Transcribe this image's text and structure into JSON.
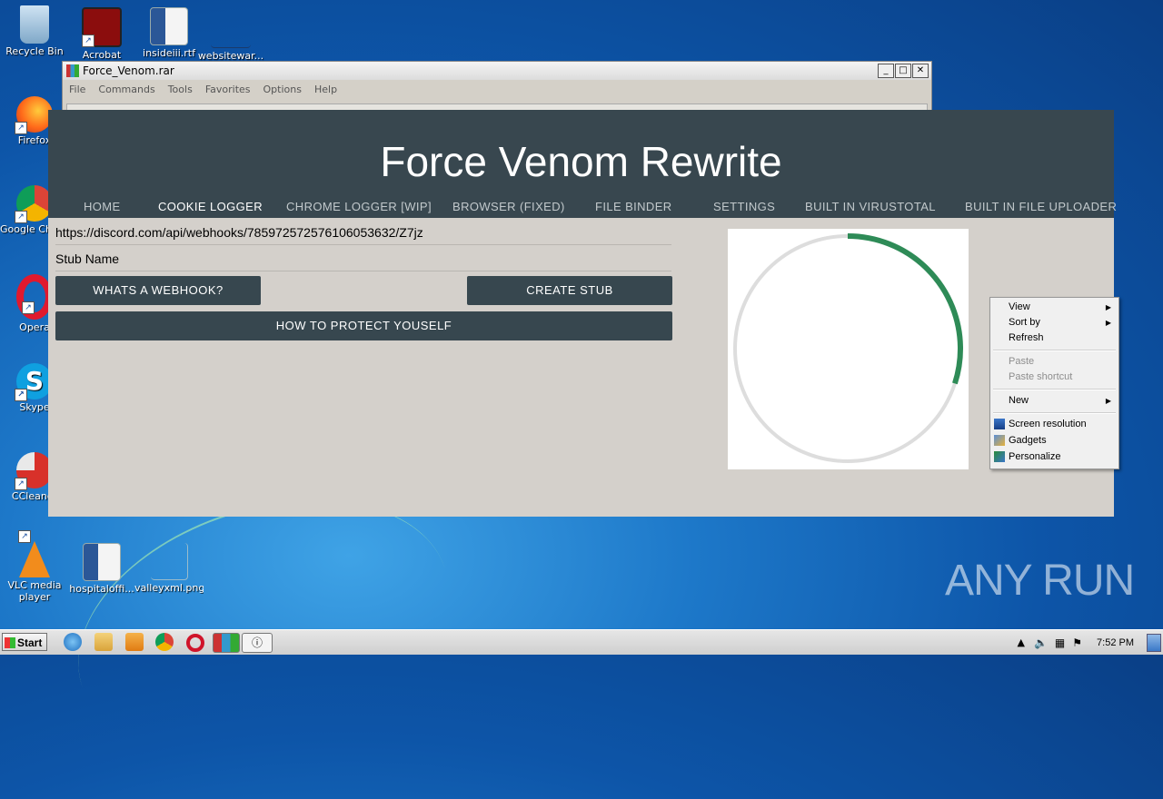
{
  "desktop": {
    "icons": [
      {
        "label": "Recycle Bin"
      },
      {
        "label": "Acrobat"
      },
      {
        "label": "insideiii.rtf"
      },
      {
        "label": "websitewar..."
      },
      {
        "label": "Firefox"
      },
      {
        "label": "Google Chrome"
      },
      {
        "label": "Opera"
      },
      {
        "label": "Skype"
      },
      {
        "label": "CCleaner"
      },
      {
        "label": "VLC media player"
      },
      {
        "label": "hospitaloffi..."
      },
      {
        "label": "valleyxml.png"
      }
    ]
  },
  "rar_window": {
    "title": "Force_Venom.rar",
    "menu": [
      "File",
      "Commands",
      "Tools",
      "Favorites",
      "Options",
      "Help"
    ]
  },
  "app": {
    "title": "Force Venom Rewrite",
    "tabs": [
      "HOME",
      "COOKIE LOGGER",
      "CHROME LOGGER [WIP]",
      "BROWSER (FIXED)",
      "FILE BINDER",
      "SETTINGS",
      "BUILT IN VIRUSTOTAL",
      "BUILT IN FILE UPLOADER"
    ],
    "active_tab": "COOKIE LOGGER",
    "webhook_value": "https://discord.com/api/webhooks/785972572576106053632/Z7jz",
    "stub_name_placeholder": "Stub Name",
    "buttons": {
      "whats_webhook": "WHATS A WEBHOOK?",
      "create_stub": "CREATE STUB",
      "how_to_protect": "HOW TO PROTECT YOUSELF"
    },
    "spinner": {
      "progress_fraction": 0.3,
      "track_color": "#dddddd",
      "arc_color": "#2e8b57"
    }
  },
  "context_menu": {
    "items": {
      "view": "View",
      "sort_by": "Sort by",
      "refresh": "Refresh",
      "paste": "Paste",
      "paste_shortcut": "Paste shortcut",
      "new": "New",
      "screen_resolution": "Screen resolution",
      "gadgets": "Gadgets",
      "personalize": "Personalize"
    }
  },
  "taskbar": {
    "start_label": "Start",
    "clock": "7:52 PM"
  },
  "watermark": "ANY RUN"
}
